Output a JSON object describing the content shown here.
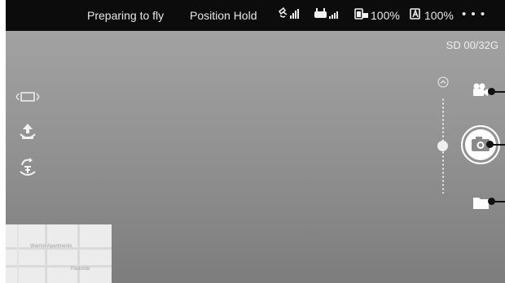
{
  "status_bar": {
    "flight_status": "Preparing to fly",
    "flight_mode": "Position Hold",
    "rc_battery": "100%",
    "aircraft_battery": "100%",
    "more_menu": "• • •"
  },
  "storage": {
    "sd_label": "SD 00/32G"
  },
  "icons": {
    "gps_signal": "satellite-signal-icon",
    "remote_signal": "remote-controller-signal-icon",
    "rc_battery": "remote-battery-icon",
    "aircraft_battery": "aircraft-battery-icon",
    "camera_mode": "video-mode-icon",
    "shutter": "camera-shutter-icon",
    "playback": "folder-icon"
  },
  "left_panel": [
    "aspect-ratio-icon",
    "takeoff-icon",
    "return-home-icon"
  ],
  "zoom_slider": {
    "level": 0.5
  },
  "minimap": {
    "labels": [
      "Warrior Apartments",
      "Parkside"
    ]
  },
  "colors": {
    "accent": "#ffffff",
    "bar": "#0c0c0c",
    "indicator": "#111111"
  }
}
